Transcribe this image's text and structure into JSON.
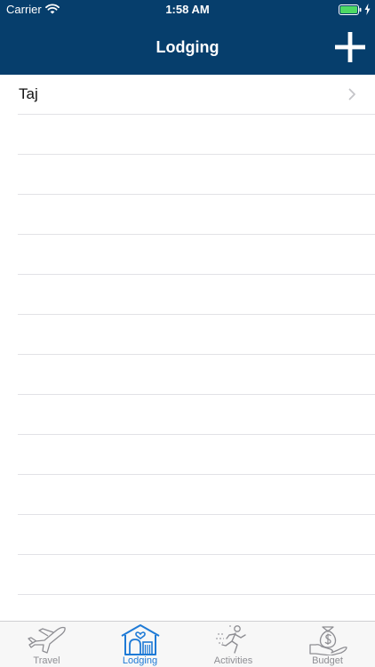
{
  "status_bar": {
    "carrier": "Carrier",
    "time": "1:58 AM",
    "icons": [
      "wifi-icon",
      "battery-icon",
      "charging-icon"
    ]
  },
  "nav": {
    "title": "Lodging",
    "add_icon": "plus-icon"
  },
  "list": {
    "items": [
      {
        "label": "Taj",
        "icon": "chevron-right-icon"
      }
    ]
  },
  "tabs": [
    {
      "label": "Travel",
      "icon": "airplane-icon",
      "active": false
    },
    {
      "label": "Lodging",
      "icon": "house-icon",
      "active": true
    },
    {
      "label": "Activities",
      "icon": "runner-icon",
      "active": false
    },
    {
      "label": "Budget",
      "icon": "money-bag-hand-icon",
      "active": false
    }
  ],
  "colors": {
    "header_background": "#063e6c",
    "header_text": "#ffffff",
    "tab_active": "#1e7ad6",
    "tab_inactive": "#8e8e93",
    "separator": "#e2e2e6"
  }
}
